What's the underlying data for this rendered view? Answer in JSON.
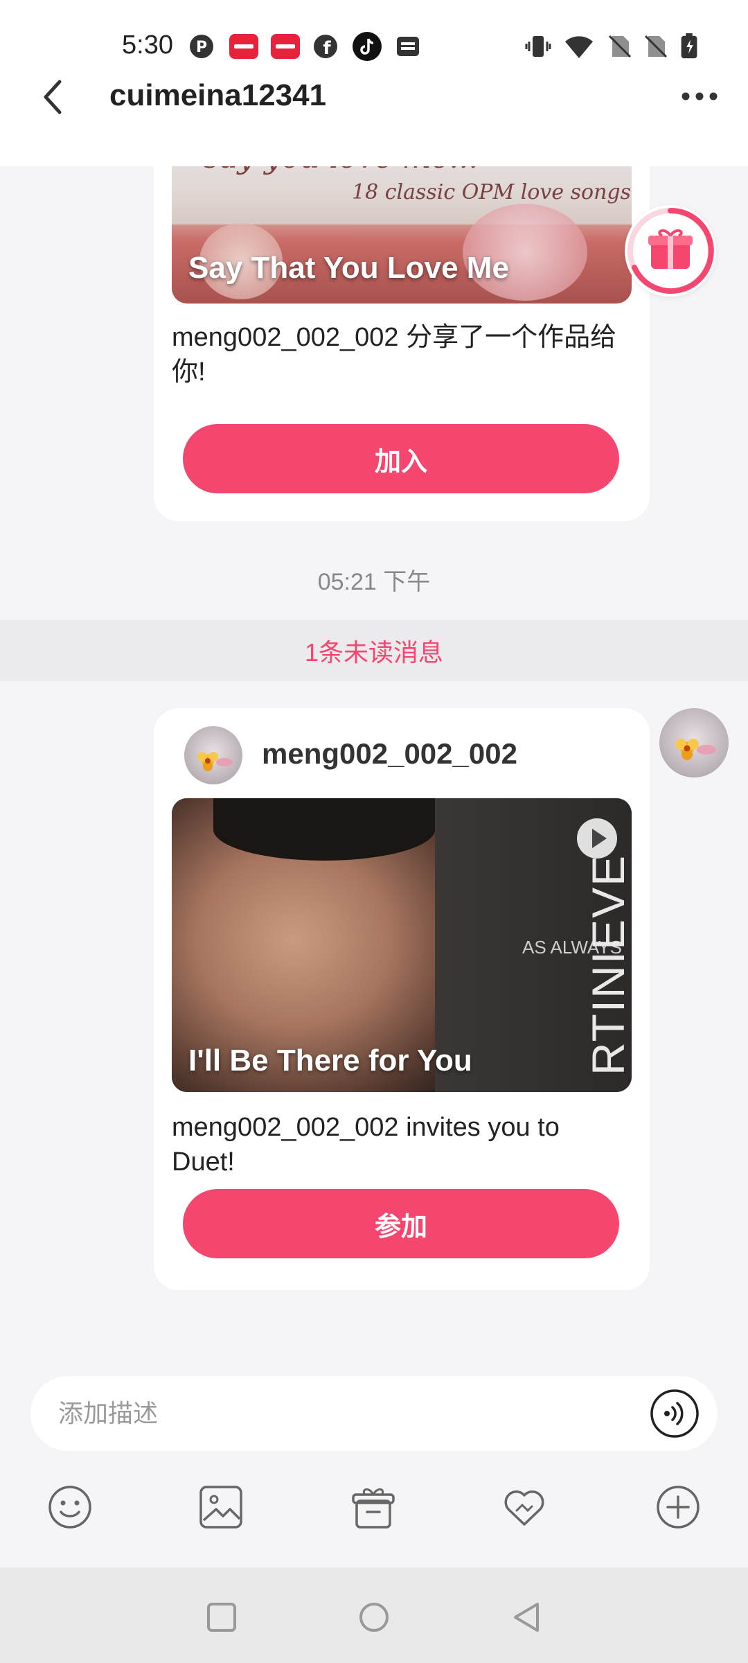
{
  "status_bar": {
    "time": "5:30",
    "left_icons": [
      "pinterest-icon",
      "xiaohongshu-icon",
      "xiaohongshu-icon",
      "facebook-icon",
      "tiktok-icon",
      "inbox-icon"
    ],
    "right_icons": [
      "vibrate-icon",
      "wifi-icon",
      "no-sim-icon",
      "no-sim-icon",
      "battery-charging-icon"
    ]
  },
  "header": {
    "title": "cuimeina12341",
    "back_icon": "chevron-left-icon",
    "more_icon": "more-dots-icon"
  },
  "messages": [
    {
      "type": "song_share",
      "thumb_top_text": "say you love me...",
      "thumb_sub_text": "18 classic OPM love songs",
      "thumb_title": "Say That You Love Me",
      "text": "meng002_002_002 分享了一个作品给你!",
      "button_label": "加入"
    },
    {
      "type": "duet_invite",
      "sender_name": "meng002_002_002",
      "thumb_title": "I'll Be There for You",
      "thumb_album_text": "AS ALWAYS",
      "thumb_side_text": "RTINIEVE",
      "text": "meng002_002_002 invites you to Duet!",
      "button_label": "参加"
    }
  ],
  "timestamp": "05:21 下午",
  "unread_notice": "1条未读消息",
  "input": {
    "placeholder": "添加描述",
    "value": ""
  },
  "toolbar": [
    "emoji-icon",
    "image-icon",
    "gift-box-icon",
    "heart-handshake-icon",
    "add-icon"
  ],
  "nav": [
    "recents-icon",
    "home-icon",
    "back-icon"
  ],
  "colors": {
    "accent": "#f4466f",
    "background": "#f5f5f7"
  }
}
